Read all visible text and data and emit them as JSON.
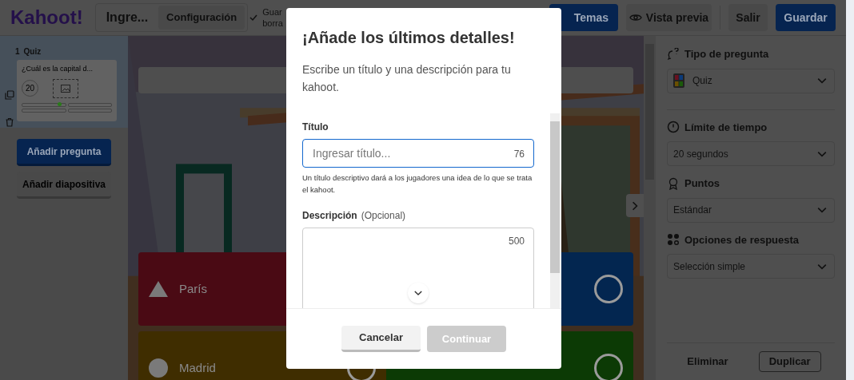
{
  "header": {
    "logo": "Kahoot!",
    "title_field": "Ingre...",
    "settings_button": "Configuración",
    "save_status": [
      "Guar",
      "borra"
    ],
    "themes_button": "Temas",
    "preview_button": "Vista previa",
    "exit_button": "Salir",
    "save_button": "Guardar"
  },
  "slides": [
    {
      "number": "1",
      "type": "Quiz",
      "question": "¿Cuál es la capital d...",
      "time": "20",
      "selected": true
    }
  ],
  "sidebar_buttons": [
    {
      "label": "Añadir pregunta",
      "kind": "primary"
    },
    {
      "label": "Añadir diapositiva",
      "kind": "secondary"
    }
  ],
  "answers": [
    {
      "text": "París",
      "kind": "triangle",
      "color": "#4a0a14"
    },
    {
      "kind": "blank",
      "color": "#032650"
    },
    {
      "text": "Madrid",
      "kind": "circle",
      "color": "#3f2d00"
    },
    {
      "kind": "blank",
      "color": "#0c3a05"
    }
  ],
  "settings": [
    {
      "kind": "type",
      "label": "Tipo de pregunta",
      "value": "Quiz"
    },
    {
      "kind": "time",
      "label": "Límite de tiempo",
      "value": "20 segundos"
    },
    {
      "kind": "points",
      "label": "Puntos",
      "value": "Estándar"
    },
    {
      "kind": "options",
      "label": "Opciones de respuesta",
      "value": "Selección simple"
    }
  ],
  "panel_actions": [
    "Eliminar",
    "Duplicar"
  ],
  "modal": {
    "title": "¡Añade los últimos detalles!",
    "description": "Escribe un título y una descripción para tu kahoot.",
    "title_label": "Título",
    "title_placeholder": "Ingresar título...",
    "title_counter": "76",
    "title_help": "Un título descriptivo dará a los jugadores una idea de lo que se trata el kahoot.",
    "description_label": "Descripción",
    "description_optional": "(Opcional)",
    "description_counter": "500",
    "cancel_button": "Cancelar",
    "continue_button": {
      "label": "Continuar",
      "disabled": true
    }
  }
}
